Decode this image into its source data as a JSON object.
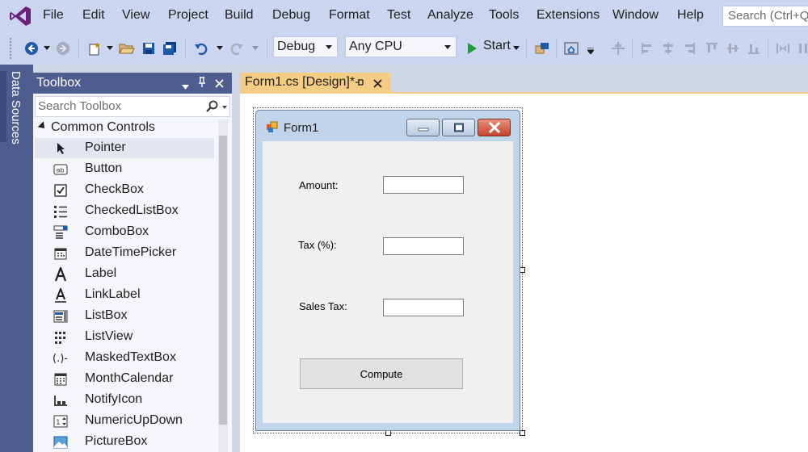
{
  "menu": {
    "items": [
      "File",
      "Edit",
      "View",
      "Project",
      "Build",
      "Debug",
      "Format",
      "Test",
      "Analyze",
      "Tools",
      "Extensions",
      "Window",
      "Help"
    ],
    "search_placeholder": "Search (Ctrl+Q)"
  },
  "toolbar": {
    "config": "Debug",
    "platform": "Any CPU",
    "start_label": "Start"
  },
  "side_tab": {
    "label": "Data Sources"
  },
  "toolbox": {
    "title": "Toolbox",
    "search_placeholder": "Search Toolbox",
    "category": "Common Controls",
    "items": [
      {
        "label": "Pointer",
        "icon": "pointer-icon",
        "selected": true
      },
      {
        "label": "Button",
        "icon": "button-control-icon"
      },
      {
        "label": "CheckBox",
        "icon": "checkbox-icon"
      },
      {
        "label": "CheckedListBox",
        "icon": "checked-listbox-icon"
      },
      {
        "label": "ComboBox",
        "icon": "combobox-icon"
      },
      {
        "label": "DateTimePicker",
        "icon": "datetimepicker-icon"
      },
      {
        "label": "Label",
        "icon": "label-icon"
      },
      {
        "label": "LinkLabel",
        "icon": "linklabel-icon"
      },
      {
        "label": "ListBox",
        "icon": "listbox-icon"
      },
      {
        "label": "ListView",
        "icon": "listview-icon"
      },
      {
        "label": "MaskedTextBox",
        "icon": "maskedtextbox-icon"
      },
      {
        "label": "MonthCalendar",
        "icon": "monthcalendar-icon"
      },
      {
        "label": "NotifyIcon",
        "icon": "notifyicon-icon"
      },
      {
        "label": "NumericUpDown",
        "icon": "numericupdown-icon"
      },
      {
        "label": "PictureBox",
        "icon": "picturebox-icon"
      }
    ]
  },
  "document_tab": {
    "label": "Form1.cs [Design]*"
  },
  "form": {
    "title": "Form1",
    "amount_label": "Amount:",
    "tax_label": "Tax (%):",
    "sales_tax_label": "Sales Tax:",
    "compute_button": "Compute"
  },
  "colors": {
    "chrome": "#ccd5f0",
    "panel_header": "#4e5d8f",
    "active_tab": "#f5cc84",
    "vs_purple": "#68217a"
  }
}
